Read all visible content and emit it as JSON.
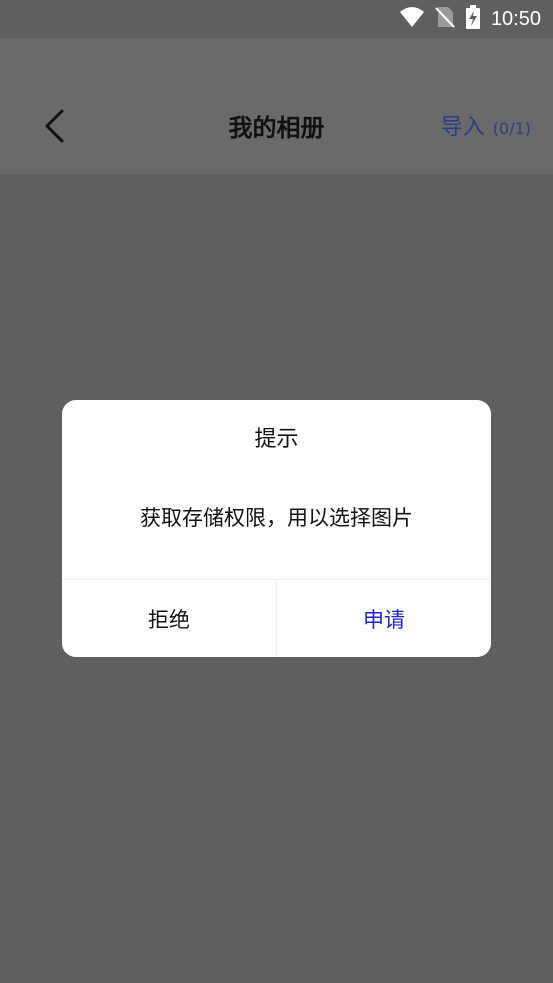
{
  "status_bar": {
    "time": "10:50",
    "icons": [
      "wifi-icon",
      "no-sim-icon",
      "battery-charging-icon"
    ]
  },
  "header": {
    "back_icon": "chevron-left-icon",
    "title": "我的相册",
    "import_label": "导入",
    "import_count": "(0/1)"
  },
  "dialog": {
    "title": "提示",
    "message": "获取存储权限，用以选择图片",
    "reject_label": "拒绝",
    "apply_label": "申请"
  },
  "colors": {
    "overlay": "#5f5f5f",
    "header": "#6a6a6a",
    "import": "#2b3f86",
    "apply": "#1d24d6"
  }
}
